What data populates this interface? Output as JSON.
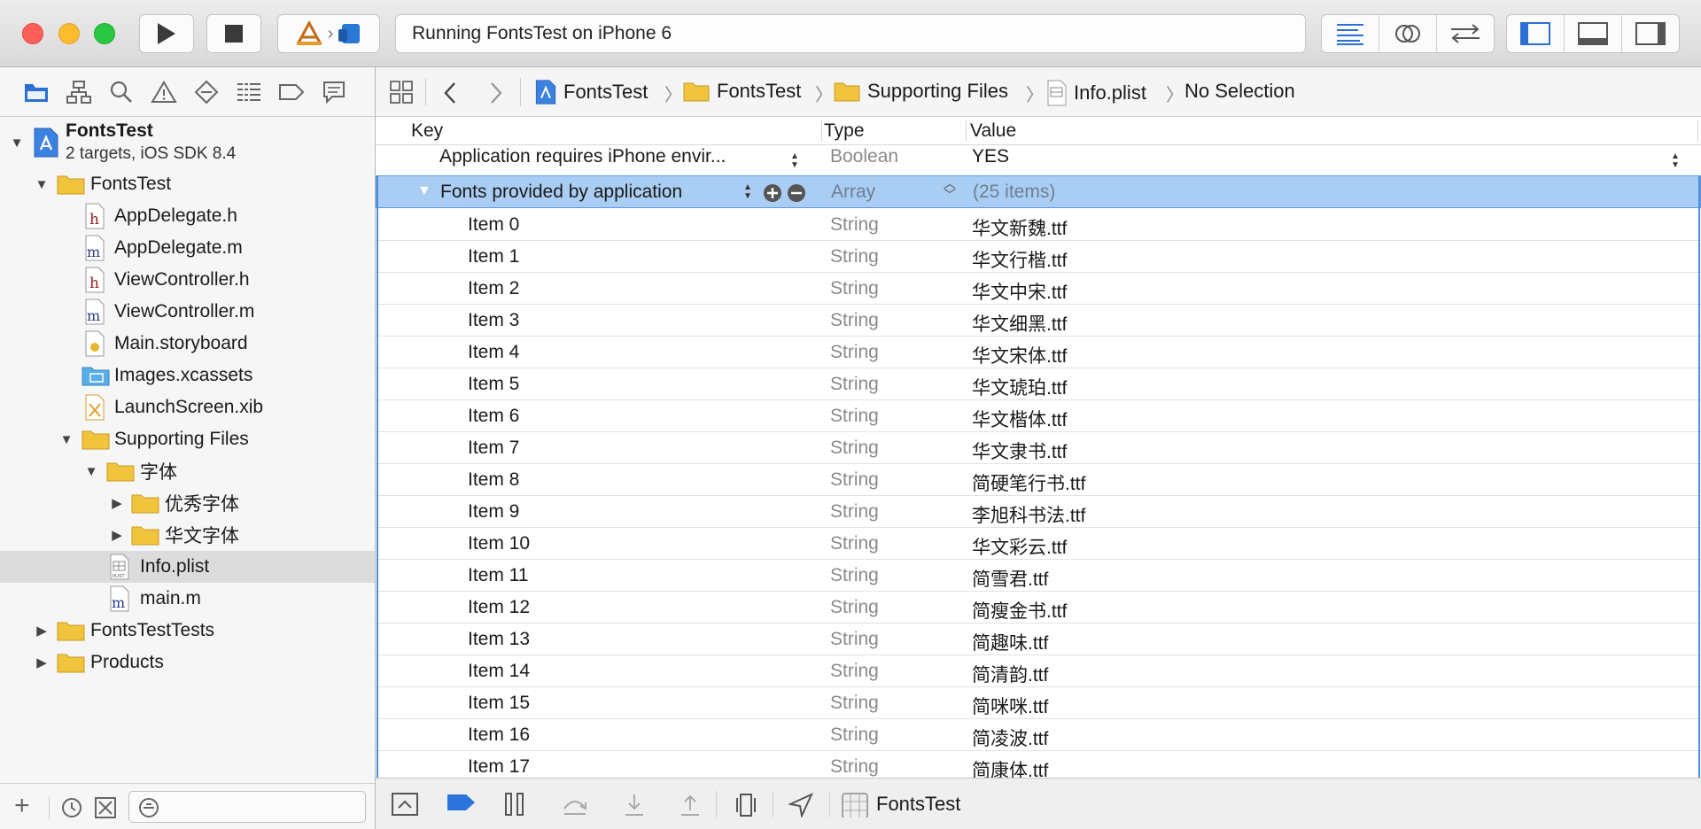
{
  "window": {
    "status_text": "Running FontsTest on iPhone 6"
  },
  "colors": {
    "accent": "#4d8fdc",
    "selection": "#a9cdf3",
    "folder": "#f0c43c"
  },
  "navigator": {
    "tabs": [
      "project-navigator-icon",
      "symbol-navigator-icon",
      "find-navigator-icon",
      "issue-navigator-icon",
      "test-navigator-icon",
      "debug-navigator-icon",
      "breakpoint-navigator-icon",
      "report-navigator-icon"
    ],
    "project": {
      "name": "FontsTest",
      "subtitle": "2 targets, iOS SDK 8.4"
    },
    "items": [
      {
        "label": "FontsTest",
        "type": "folder",
        "expanded": true
      },
      {
        "label": "AppDelegate.h",
        "type": "h"
      },
      {
        "label": "AppDelegate.m",
        "type": "m"
      },
      {
        "label": "ViewController.h",
        "type": "h"
      },
      {
        "label": "ViewController.m",
        "type": "m"
      },
      {
        "label": "Main.storyboard",
        "type": "storyboard"
      },
      {
        "label": "Images.xcassets",
        "type": "xcassets"
      },
      {
        "label": "LaunchScreen.xib",
        "type": "xib"
      },
      {
        "label": "Supporting Files",
        "type": "folder",
        "expanded": true
      },
      {
        "label": "字体",
        "type": "folder",
        "expanded": true
      },
      {
        "label": "优秀字体",
        "type": "folder",
        "expanded": false
      },
      {
        "label": "华文字体",
        "type": "folder",
        "expanded": false
      },
      {
        "label": "Info.plist",
        "type": "plist",
        "selected": true
      },
      {
        "label": "main.m",
        "type": "m"
      },
      {
        "label": "FontsTestTests",
        "type": "folder",
        "expanded": false
      },
      {
        "label": "Products",
        "type": "folder",
        "expanded": false
      }
    ]
  },
  "jumpbar": {
    "crumbs": [
      "FontsTest",
      "FontsTest",
      "Supporting Files",
      "Info.plist",
      "No Selection"
    ]
  },
  "plist": {
    "headers": {
      "key": "Key",
      "type": "Type",
      "value": "Value"
    },
    "rows": [
      {
        "key": "Application requires iPhone envir...",
        "type": "Boolean",
        "value": "YES"
      },
      {
        "key": "Fonts provided by application",
        "type": "Array",
        "value": "(25 items)"
      },
      {
        "key": "Item 0",
        "type": "String",
        "value": "华文新魏.ttf"
      },
      {
        "key": "Item 1",
        "type": "String",
        "value": "华文行楷.ttf"
      },
      {
        "key": "Item 2",
        "type": "String",
        "value": "华文中宋.ttf"
      },
      {
        "key": "Item 3",
        "type": "String",
        "value": "华文细黑.ttf"
      },
      {
        "key": "Item 4",
        "type": "String",
        "value": "华文宋体.ttf"
      },
      {
        "key": "Item 5",
        "type": "String",
        "value": "华文琥珀.ttf"
      },
      {
        "key": "Item 6",
        "type": "String",
        "value": "华文楷体.ttf"
      },
      {
        "key": "Item 7",
        "type": "String",
        "value": "华文隶书.ttf"
      },
      {
        "key": "Item 8",
        "type": "String",
        "value": "简硬笔行书.ttf"
      },
      {
        "key": "Item 9",
        "type": "String",
        "value": "李旭科书法.ttf"
      },
      {
        "key": "Item 10",
        "type": "String",
        "value": "华文彩云.ttf"
      },
      {
        "key": "Item 11",
        "type": "String",
        "value": "简雪君.ttf"
      },
      {
        "key": "Item 12",
        "type": "String",
        "value": "简瘦金书.ttf"
      },
      {
        "key": "Item 13",
        "type": "String",
        "value": "简趣味.ttf"
      },
      {
        "key": "Item 14",
        "type": "String",
        "value": "简清韵.ttf"
      },
      {
        "key": "Item 15",
        "type": "String",
        "value": "简咪咪.ttf"
      },
      {
        "key": "Item 16",
        "type": "String",
        "value": "简凌波.ttf"
      },
      {
        "key": "Item 17",
        "type": "String",
        "value": "简康体.ttf"
      }
    ]
  },
  "debugbar": {
    "label": "FontsTest"
  }
}
